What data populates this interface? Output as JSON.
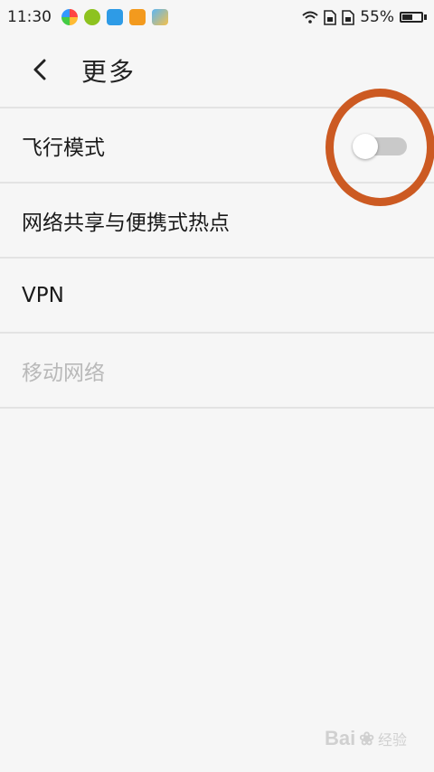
{
  "status_bar": {
    "time": "11:30",
    "battery_percent": "55%",
    "battery_level": 0.55,
    "icons": [
      "app-icon-multicolor",
      "app-icon-green-refresh",
      "app-icon-blue-scan",
      "app-icon-orange-search",
      "app-icon-gallery",
      "wifi-icon",
      "sim-1-icon",
      "sim-2-icon",
      "battery-icon"
    ]
  },
  "header": {
    "title": "更多",
    "back_icon": "chevron-left-icon"
  },
  "settings": {
    "items": [
      {
        "label": "飞行模式",
        "control": "toggle",
        "on": false
      },
      {
        "label": "网络共享与便携式热点"
      },
      {
        "label": "VPN"
      },
      {
        "label": "移动网络",
        "disabled": true
      }
    ]
  },
  "annotation": {
    "color": "#cc5a22",
    "shape": "circle-around-toggle"
  },
  "watermark": {
    "text": "Bai",
    "text2": "经验"
  },
  "colors": {
    "background": "#f6f6f6",
    "divider": "#e3e3e3",
    "disabled_text": "#b9b9b9",
    "toggle_off": "#c9c9c9"
  }
}
